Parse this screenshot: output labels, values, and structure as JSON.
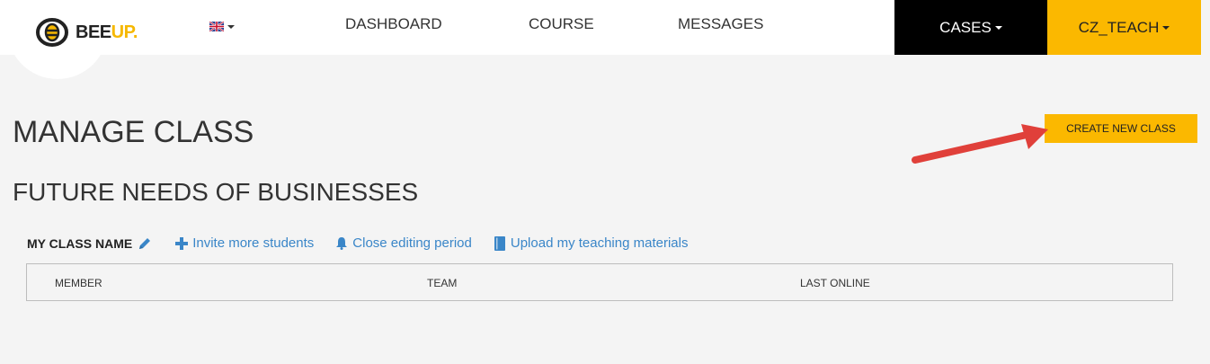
{
  "brand": {
    "name_main": "BEE",
    "name_accent": "UP."
  },
  "nav": {
    "dashboard": "DASHBOARD",
    "course": "COURSE",
    "messages": "MESSAGES",
    "cases": "CASES",
    "user": "CZ_TEACH"
  },
  "page": {
    "title": "MANAGE CLASS",
    "create_button": "CREATE NEW CLASS",
    "course_title": "FUTURE NEEDS OF BUSINESSES"
  },
  "class_bar": {
    "class_name": "MY CLASS NAME",
    "invite": "Invite more students",
    "close": "Close editing period",
    "upload": "Upload my teaching materials"
  },
  "table": {
    "columns": [
      "MEMBER",
      "TEAM",
      "LAST ONLINE"
    ]
  },
  "colors": {
    "accent": "#fbb800",
    "link": "#3a86c8",
    "annotation_arrow": "#e0403a"
  }
}
